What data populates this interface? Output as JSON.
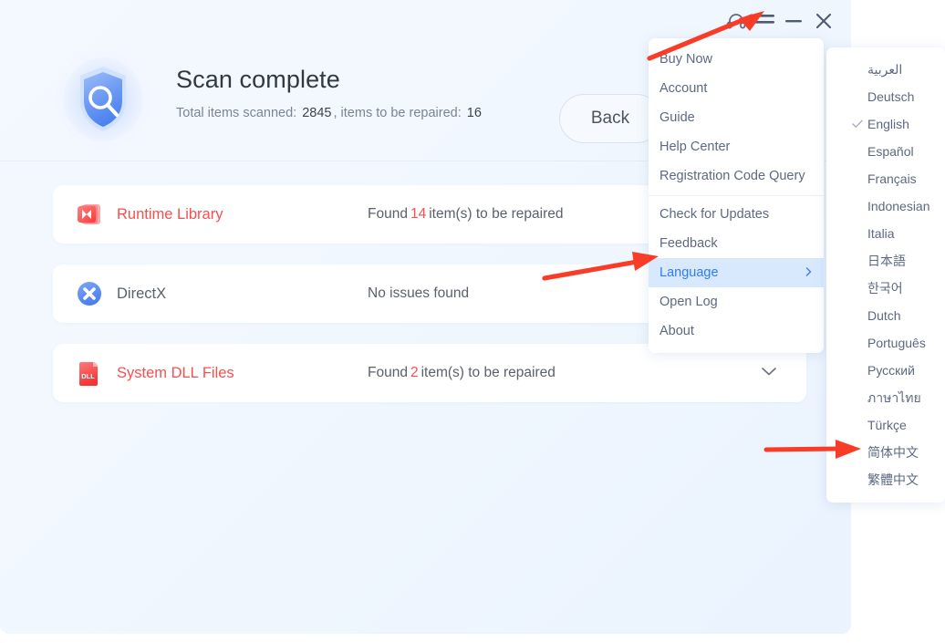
{
  "titlebar": {
    "buttons": [
      {
        "name": "support-headset-icon",
        "label": "Support"
      },
      {
        "name": "hamburger-menu-icon",
        "label": "Menu"
      },
      {
        "name": "minimize-icon",
        "label": "Minimize"
      },
      {
        "name": "close-icon",
        "label": "Close"
      }
    ]
  },
  "header": {
    "title": "Scan complete",
    "scanned_label": "Total items scanned:",
    "scanned_count": "2845",
    "comma": ",",
    "repair_label": "items to be repaired:",
    "repair_count": "16",
    "back_label": "Back",
    "icon": "shield-search-icon"
  },
  "cards": [
    {
      "icon": "visual-studio-runtime-icon",
      "name": "Runtime Library",
      "name_state": "alert",
      "status_prefix": "Found",
      "count": "14",
      "status_suffix": "item(s) to be repaired",
      "has_chevron": false
    },
    {
      "icon": "directx-icon",
      "name": "DirectX",
      "name_state": "ok",
      "status_prefix": "No issues found",
      "count": "",
      "status_suffix": "",
      "has_chevron": false
    },
    {
      "icon": "dll-file-icon",
      "name": "System DLL Files",
      "name_state": "alert",
      "status_prefix": "Found",
      "count": "2",
      "status_suffix": "item(s) to be repaired",
      "has_chevron": true
    }
  ],
  "menu": {
    "items": [
      {
        "label": "Buy Now",
        "active": false,
        "submenu": false,
        "sep_after": false
      },
      {
        "label": "Account",
        "active": false,
        "submenu": false,
        "sep_after": false
      },
      {
        "label": "Guide",
        "active": false,
        "submenu": false,
        "sep_after": false
      },
      {
        "label": "Help Center",
        "active": false,
        "submenu": false,
        "sep_after": false
      },
      {
        "label": "Registration Code Query",
        "active": false,
        "submenu": false,
        "sep_after": true
      },
      {
        "label": "Check for Updates",
        "active": false,
        "submenu": false,
        "sep_after": false
      },
      {
        "label": "Feedback",
        "active": false,
        "submenu": false,
        "sep_after": false
      },
      {
        "label": "Language",
        "active": true,
        "submenu": true,
        "sep_after": false
      },
      {
        "label": "Open Log",
        "active": false,
        "submenu": false,
        "sep_after": false
      },
      {
        "label": "About",
        "active": false,
        "submenu": false,
        "sep_after": false
      }
    ]
  },
  "languages": {
    "selected": "English",
    "items": [
      {
        "label": "العربية",
        "checked": false
      },
      {
        "label": "Deutsch",
        "checked": false
      },
      {
        "label": "English",
        "checked": true
      },
      {
        "label": "Español",
        "checked": false
      },
      {
        "label": "Français",
        "checked": false
      },
      {
        "label": "Indonesian",
        "checked": false
      },
      {
        "label": "Italia",
        "checked": false
      },
      {
        "label": "日本語",
        "checked": false
      },
      {
        "label": "한국어",
        "checked": false
      },
      {
        "label": "Dutch",
        "checked": false
      },
      {
        "label": "Português",
        "checked": false
      },
      {
        "label": "Русский",
        "checked": false
      },
      {
        "label": "ภาษาไทย",
        "checked": false
      },
      {
        "label": "Türkçe",
        "checked": false
      },
      {
        "label": "简体中文",
        "checked": false
      },
      {
        "label": "繁體中文",
        "checked": false
      }
    ]
  },
  "annotations": {
    "arrow_color": "#f93c28",
    "arrows": [
      {
        "name": "arrow-to-hamburger-menu",
        "target": "hamburger-menu-icon"
      },
      {
        "name": "arrow-to-language-item",
        "target": "Language"
      },
      {
        "name": "arrow-to-simplified-chinese",
        "target": "简体中文"
      }
    ]
  },
  "colors": {
    "app_background": "#f1f7fe",
    "card_background": "#ffffff",
    "alert": "#fa4e4e",
    "accent": "#2f7cf6",
    "menu_text": "#5d6881",
    "menu_highlight": "#d8e9fd"
  }
}
